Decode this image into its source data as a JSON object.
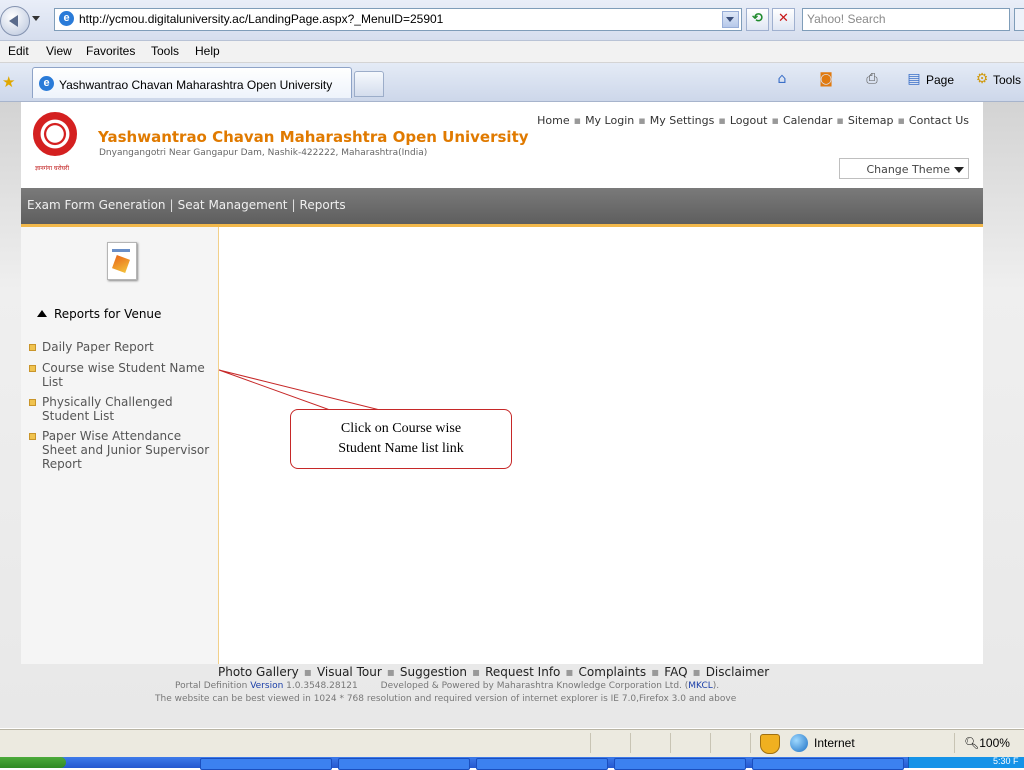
{
  "browser": {
    "url": "http://ycmou.digitaluniversity.ac/LandingPage.aspx?_MenuID=25901",
    "search_placeholder": "Yahoo! Search",
    "menu": [
      "Edit",
      "View",
      "Favorites",
      "Tools",
      "Help"
    ],
    "tab_title": "Yashwantrao Chavan Maharashtra Open University",
    "commands": {
      "page": "Page",
      "tools": "Tools"
    }
  },
  "site": {
    "logo_caption": "ज्ञानगंगा घरोघरी",
    "name": "Yashwantrao Chavan Maharashtra Open University",
    "address": "Dnyangangotri Near Gangapur Dam, Nashik-422222, Maharashtra(India)",
    "top_links": [
      "Home",
      "My Login",
      "My Settings",
      "Logout",
      "Calendar",
      "Sitemap",
      "Contact Us"
    ],
    "change_theme": "Change Theme",
    "main_menu": [
      "Exam Form Generation",
      "Seat Management",
      "Reports"
    ]
  },
  "sidebar": {
    "section_title": "Reports for Venue",
    "items": [
      "Daily Paper Report",
      "Course wise Student Name List",
      "Physically Challenged Student List",
      "Paper Wise Attendance Sheet and Junior Supervisor Report"
    ]
  },
  "callout": {
    "line1": "Click on Course wise",
    "line2": "Student Name list link"
  },
  "footer": {
    "links": [
      "Photo Gallery",
      "Visual Tour",
      "Suggestion",
      "Request Info",
      "Complaints",
      "FAQ",
      "Disclaimer"
    ],
    "portal_label": "Portal Definition",
    "version_label": "Version",
    "version": "1.0.3548.28121",
    "developed_by": "Developed & Powered by Maharashtra Knowledge Corporation Ltd. (",
    "mkcl": "MKCL",
    "developed_end": ").",
    "best_viewed": "The website can be best viewed in 1024 * 768 resolution and required version of internet explorer is IE 7.0,Firefox 3.0 and above"
  },
  "statusbar": {
    "zone": "Internet",
    "zoom": "100%"
  },
  "taskbar": {
    "clock": "5:30 F"
  }
}
